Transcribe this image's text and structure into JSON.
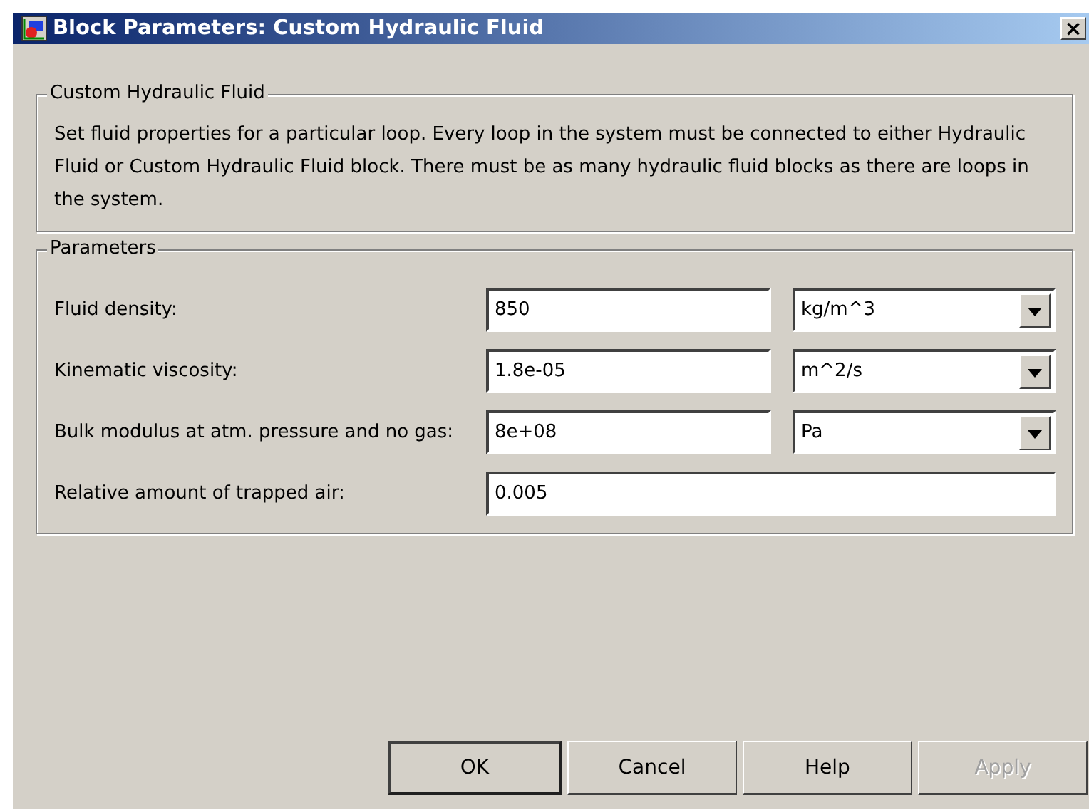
{
  "window": {
    "title": "Block Parameters: Custom Hydraulic Fluid",
    "close": "×"
  },
  "description": {
    "title": "Custom Hydraulic Fluid",
    "text": "Set fluid properties for a particular loop. Every loop in the system must be connected to either Hydraulic Fluid or Custom Hydraulic Fluid block. There must be as many hydraulic fluid blocks as there are loops in the system."
  },
  "parameters": {
    "title": "Parameters",
    "rows": [
      {
        "label": "Fluid density:",
        "value": "850",
        "unit": "kg/m^3"
      },
      {
        "label": "Kinematic viscosity:",
        "value": "1.8e-05",
        "unit": "m^2/s"
      },
      {
        "label": "Bulk modulus at atm. pressure and no gas:",
        "value": "8e+08",
        "unit": "Pa"
      },
      {
        "label": "Relative amount of trapped air:",
        "value": "0.005"
      }
    ]
  },
  "buttons": [
    {
      "label": "OK",
      "default": true,
      "disabled": false
    },
    {
      "label": "Cancel",
      "default": false,
      "disabled": false
    },
    {
      "label": "Help",
      "default": false,
      "disabled": false
    },
    {
      "label": "Apply",
      "default": false,
      "disabled": true
    }
  ]
}
